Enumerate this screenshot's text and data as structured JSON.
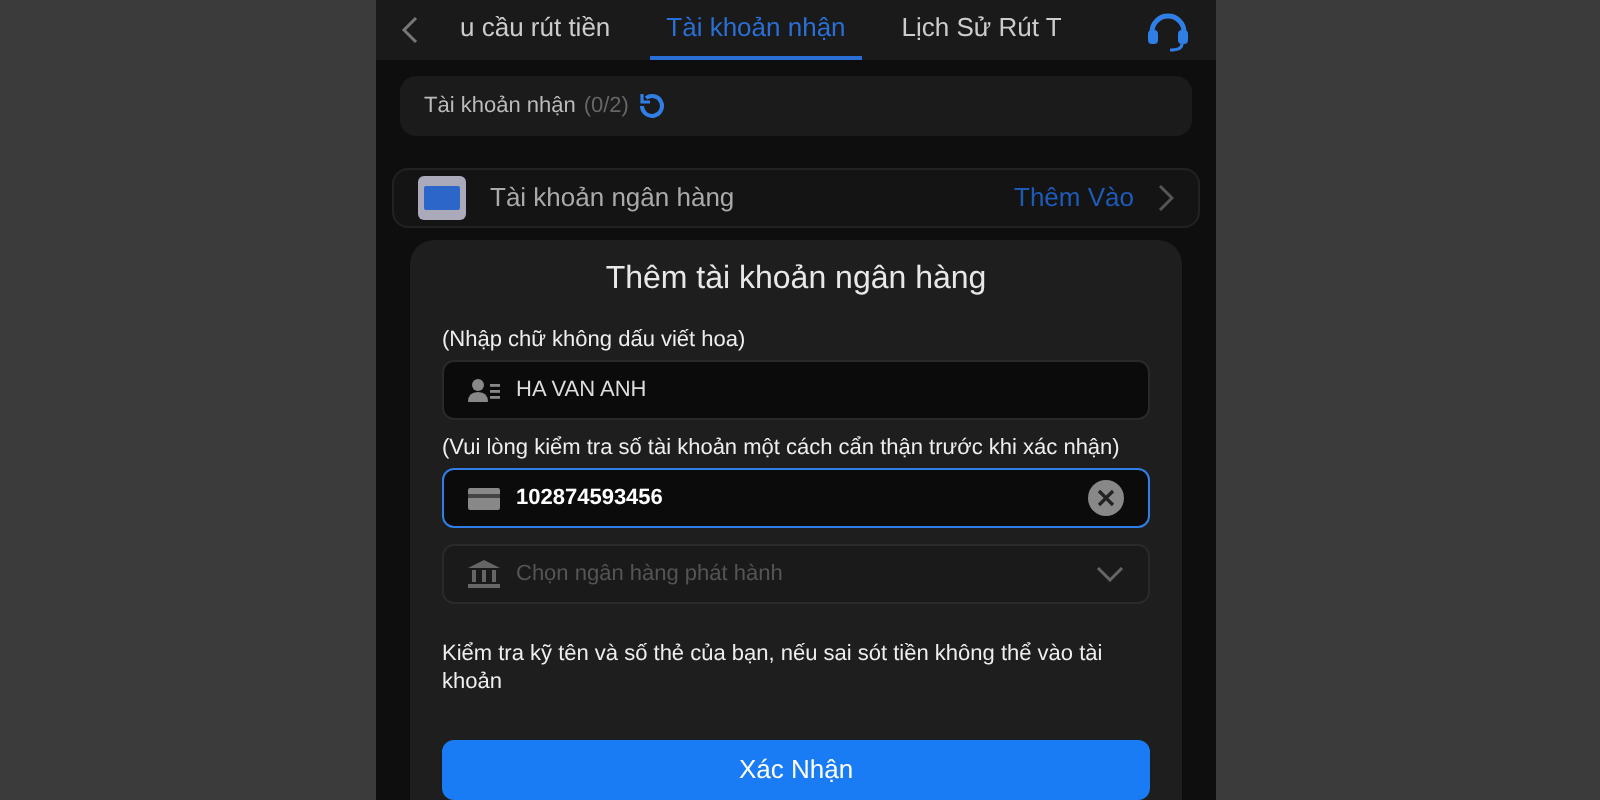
{
  "header": {
    "tabs": [
      {
        "label": "u cầu rút tiền",
        "selected": false
      },
      {
        "label": "Tài khoản nhận",
        "selected": true
      },
      {
        "label": "Lịch Sử Rút T",
        "selected": false
      }
    ]
  },
  "accounts_bar": {
    "label": "Tài khoản nhận",
    "count": "(0/2)"
  },
  "bank_row": {
    "label": "Tài khoản ngân hàng",
    "action": "Thêm Vào"
  },
  "dialog": {
    "title": "Thêm tài khoản ngân hàng",
    "fields": [
      {
        "kind": "text",
        "hint": "(Nhập chữ không dấu viết hoa)",
        "value": "HA VAN ANH",
        "focused": false
      },
      {
        "kind": "card",
        "hint": "(Vui lòng kiểm tra số tài khoản một cách cẩn thận trước khi xác nhận)",
        "value": "102874593456",
        "focused": true
      },
      {
        "kind": "select",
        "placeholder": "Chọn ngân hàng phát hành",
        "focused": false
      }
    ],
    "note": "Kiểm tra kỹ tên và số thẻ của bạn, nếu sai sót tiền không thể vào tài khoản",
    "button": "Xác Nhận"
  }
}
